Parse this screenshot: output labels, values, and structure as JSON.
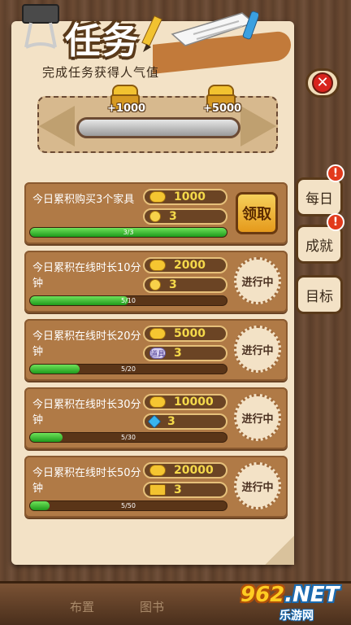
{
  "header": {
    "title": "任务",
    "subtitle": "完成任务获得人气值"
  },
  "progress": {
    "milestones": [
      {
        "label": "+1000"
      },
      {
        "label": "+5000"
      }
    ],
    "fill": 0
  },
  "side_tabs": [
    {
      "label": "每日",
      "badge": "!"
    },
    {
      "label": "成就",
      "badge": "!"
    },
    {
      "label": "目标",
      "badge": ""
    }
  ],
  "tasks": [
    {
      "desc": "今日累积购买3个家具",
      "coins": "1000",
      "reward_icon": "bulb-icon",
      "reward": "3",
      "progress": "3/3",
      "fill": 1.0,
      "status": "领取",
      "claimable": true
    },
    {
      "desc": "今日累积在线时长10分钟",
      "coins": "2000",
      "reward_icon": "bulb-icon",
      "reward": "3",
      "progress": "5/10",
      "fill": 0.5,
      "status": "进行中",
      "claimable": false
    },
    {
      "desc": "今日累积在线时长20分钟",
      "coins": "5000",
      "reward_icon": "ticket-icon",
      "reward_icon_text": "道具",
      "reward": "3",
      "progress": "5/20",
      "fill": 0.25,
      "status": "进行中",
      "claimable": false
    },
    {
      "desc": "今日累积在线时长30分钟",
      "coins": "10000",
      "reward_icon": "diamond-icon",
      "reward": "3",
      "progress": "5/30",
      "fill": 0.1667,
      "status": "进行中",
      "claimable": false
    },
    {
      "desc": "今日累积在线时长50分钟",
      "coins": "20000",
      "reward_icon": "crown-icon",
      "reward": "3",
      "progress": "5/50",
      "fill": 0.1,
      "status": "进行中",
      "claimable": false
    }
  ],
  "bottom_bar": {
    "items": [
      "布置",
      "图书"
    ]
  },
  "watermark": {
    "top_prefix": "",
    "top_num": "962",
    "top_suffix": ".NET",
    "bottom": "乐游网"
  }
}
